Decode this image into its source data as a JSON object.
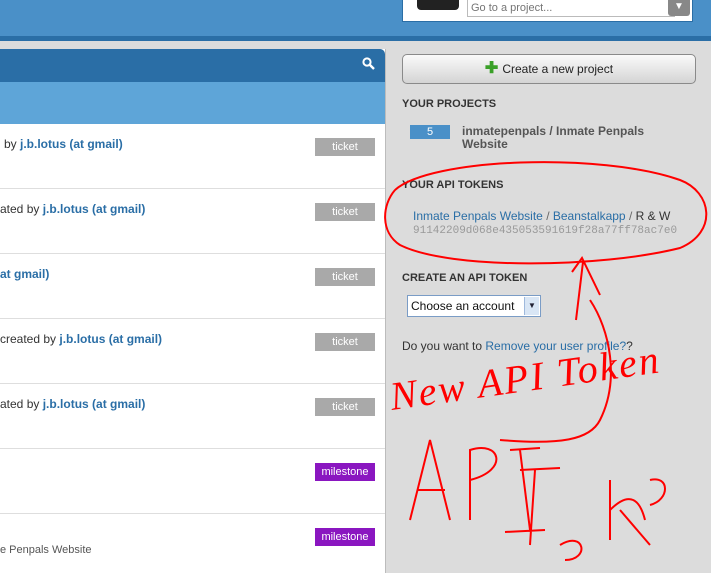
{
  "header": {
    "project_placeholder": "Go to a project...",
    "project_dropdown_icon": "chevron-down-icon"
  },
  "main": {
    "search_icon": "search-icon",
    "rows": [
      {
        "prefix": "by ",
        "user": "j.b.lotus (at gmail)",
        "badge": "ticket"
      },
      {
        "prefix": "ated by ",
        "user": "j.b.lotus (at gmail)",
        "badge": "ticket"
      },
      {
        "prefix": "",
        "user": "at gmail)",
        "badge": "ticket"
      },
      {
        "prefix": "created by ",
        "user": "j.b.lotus (at gmail)",
        "badge": "ticket"
      },
      {
        "prefix": "ated by ",
        "user": "j.b.lotus (at gmail)",
        "badge": "ticket"
      },
      {
        "prefix": "",
        "user": "",
        "badge": "milestone"
      },
      {
        "prefix": "",
        "user": "",
        "badge": "milestone",
        "sub": "e Penpals Website"
      }
    ]
  },
  "sidebar": {
    "create_button": "Create a new project",
    "your_projects_title": "YOUR PROJECTS",
    "project_count": "5",
    "project_name": "inmatepenpals / Inmate Penpals Website",
    "api_tokens_title": "YOUR API TOKENS",
    "token_project": "Inmate Penpals Website",
    "token_sep1": " / ",
    "token_account": "Beanstalkapp",
    "token_sep2": " / ",
    "token_perm": "R & W",
    "token_value": "91142209d068e435053591619f28a77ff78ac7e0",
    "create_token_title": "CREATE AN API TOKEN",
    "account_select": "Choose an account",
    "remove_prefix": "Do you want to ",
    "remove_link": "Remove your user profile?",
    "remove_suffix": "?"
  },
  "annotation": {
    "handwritten": "New API Token",
    "color": "#ff0000"
  }
}
